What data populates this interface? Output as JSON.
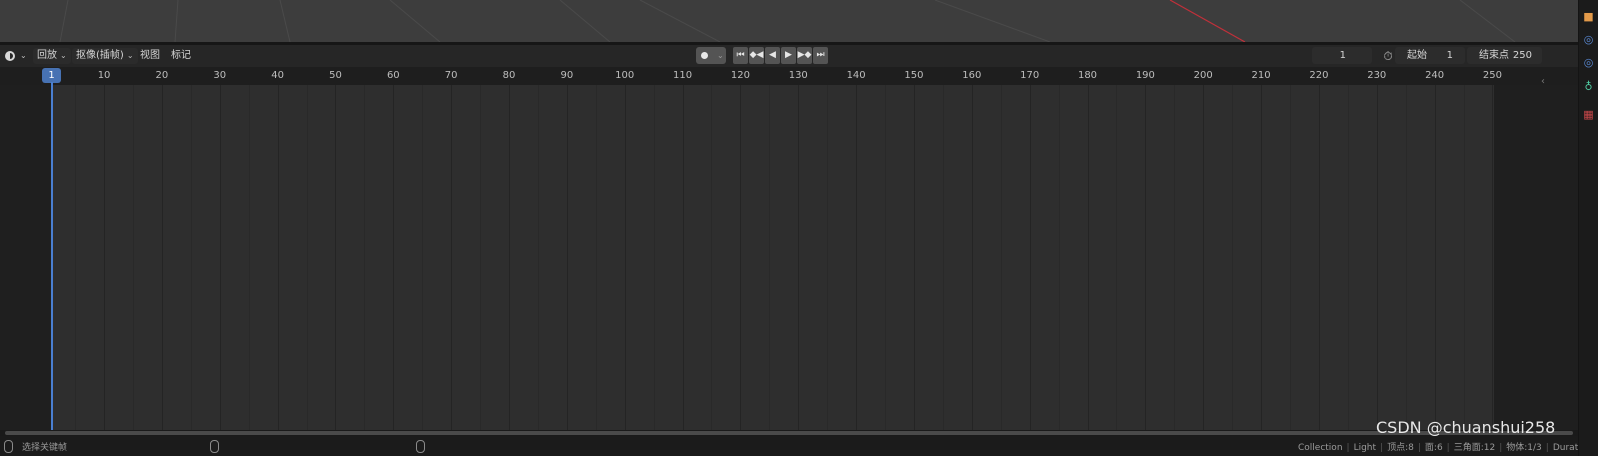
{
  "header": {
    "menus": [
      {
        "label": "回放",
        "has_dropdown": true
      },
      {
        "label": "抠像(插帧)",
        "has_dropdown": true
      },
      {
        "label": "视图",
        "has_dropdown": false
      },
      {
        "label": "标记",
        "has_dropdown": false
      }
    ],
    "transport_icons": [
      "jump-to-start-icon",
      "jump-to-prev-keyframe-icon",
      "play-reverse-icon",
      "play-icon",
      "jump-to-next-keyframe-icon",
      "jump-to-end-icon"
    ],
    "current_frame": "1",
    "start_label": "起始",
    "start_value": "1",
    "end_label": "结束点",
    "end_value": "250"
  },
  "timeline": {
    "current_frame_marker": "1",
    "ticks": [
      "10",
      "20",
      "30",
      "40",
      "50",
      "60",
      "70",
      "80",
      "90",
      "100",
      "110",
      "120",
      "130",
      "140",
      "150",
      "160",
      "170",
      "180",
      "190",
      "200",
      "210",
      "220",
      "230",
      "240",
      "250"
    ],
    "frame_start": 1,
    "frame_end": 250
  },
  "statusbar": {
    "left_text": "选择关键帧",
    "right_items": [
      "Collection",
      "Light",
      "顶点:8",
      "面:6",
      "三角面:12",
      "物体:1/3",
      "Duration"
    ]
  },
  "watermark": "CSDN @chuanshui258",
  "colors": {
    "accent": "#4772b3",
    "playhead": "#4a7fd1",
    "frame_range_bg": "#2e2e2e",
    "header_bg": "#262626",
    "x_axis_red": "#c0303a"
  }
}
